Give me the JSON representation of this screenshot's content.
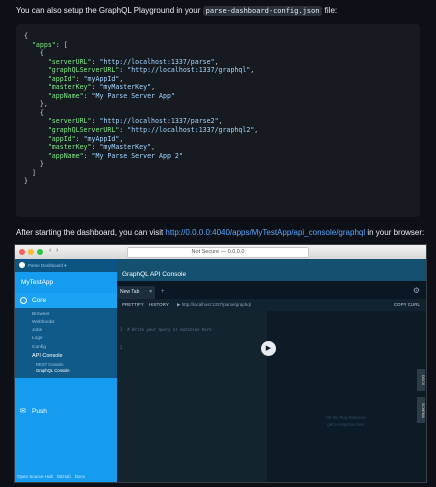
{
  "intro": {
    "text_before": "You can also setup the GraphQL Playground in your ",
    "file_name": "parse-dashboard-config.json",
    "text_after": " file:"
  },
  "code_lines": [
    "{",
    "  \"apps\": [",
    "    {",
    "      \"serverURL\": \"http://localhost:1337/parse\",",
    "      \"graphQLServerURL\": \"http://localhost:1337/graphql\",",
    "      \"appId\": \"myAppId\",",
    "      \"masterKey\": \"myMasterKey\",",
    "      \"appName\": \"My Parse Server App\"",
    "    },",
    "    {",
    "      \"serverURL\": \"http://localhost:1337/parse2\",",
    "      \"graphQLServerURL\": \"http://localhost:1337/graphql2\",",
    "      \"appId\": \"myAppId\",",
    "      \"masterKey\": \"myMasterKey\",",
    "      \"appName\": \"My Parse Server App 2\"",
    "    }",
    "  ]",
    "}"
  ],
  "after": {
    "text_before": "After starting the dashboard, you can visit ",
    "link": "http://0.0.0.0:4040/apps/MyTestApp/api_console/graphql",
    "text_after": " in your browser:"
  },
  "screenshot": {
    "url": "Not Secure — 0.0.0.0",
    "header_brand": "Parse Dashboard ▾",
    "app_name": "MyTestApp",
    "core_label": "Core",
    "sub_items": [
      "Browser",
      "Webhooks",
      "Jobs",
      "Logs",
      "Config",
      "API Console",
      "REST Console",
      "GraphQL Console"
    ],
    "push_label": "Push",
    "footer_links": [
      "Open Source Hub",
      "GitHub",
      "Docs"
    ],
    "page_title": "GraphQL API Console",
    "tab_label": "New Tab",
    "tab_close": "×",
    "tab_add": "+",
    "toolbar": {
      "prettify": "PRETTIFY",
      "history": "HISTORY",
      "endpoint": "▶ http://localhost:1337/parse/graphql",
      "copy_curl": "COPY CURL"
    },
    "editor_lines": [
      "1  # Write your query or mutation here",
      "2"
    ],
    "side_tabs": [
      "DOCS",
      "SCHEMA"
    ],
    "hint_line1": "Hit the Play Button to",
    "hint_line2": "get a response here"
  },
  "colors": {
    "page_bg": "#0d1117",
    "link": "#58a6ff",
    "sidebar_blue": "#169cee",
    "sidebar_dark": "#0c5582"
  }
}
